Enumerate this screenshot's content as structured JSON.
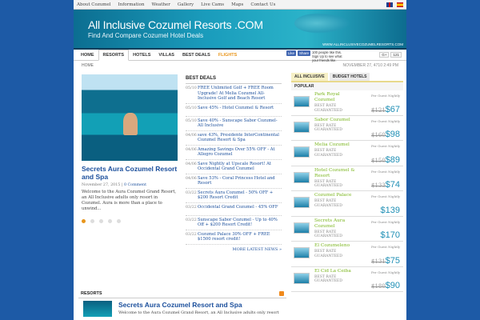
{
  "topnav": [
    "About Cozumel",
    "Information",
    "Weather",
    "Gallery",
    "Live Cams",
    "Maps",
    "Contact Us"
  ],
  "banner": {
    "title": "All Inclusive Cozumel Resorts .COM",
    "subtitle": "Find And Compare Cozumel Hotel Deals",
    "url": "WWW.ALLINCLUSIVECOZUMELRESORTS.COM"
  },
  "mainnav": [
    "HOME",
    "RESORTS",
    "HOTELS",
    "VILLAS",
    "BEST DEALS",
    "FLIGHTS"
  ],
  "facebook": {
    "like": "Like",
    "share": "Share",
    "text": "100 people like this. Sign Up to see what your friends like."
  },
  "gplus": {
    "label": "G+",
    "count": "121"
  },
  "crumbs": {
    "home": "HOME",
    "date": "NOVEMBER 27, 4710 2:49 PM"
  },
  "feature": {
    "title": "Secrets Aura Cozumel Resort and Spa",
    "date": "November 27, 2015",
    "comments": "0 Comment",
    "text": "Welcome to the Aura Cozumel Grand Resort, an All Inclusive adults only resort in Cozumel. Aura is more than a place to unwind..."
  },
  "deals": {
    "heading": "BEST DEALS",
    "items": [
      {
        "date": "05/10",
        "text": "FREE Unlimited Golf + FREE Room Upgrade! At Melia Cozumel All-Inclusive Golf and Beach Resort"
      },
      {
        "date": "05/10",
        "text": "Save 45% - Hotel Cozumel & Resort"
      },
      {
        "date": "05/10",
        "text": "Save 40% - Sunscape Sabor Cozumel-All Inclusive"
      },
      {
        "date": "04/06",
        "text": "save 43%, Presidente InterContinental Cozumel Resort & Spa"
      },
      {
        "date": "04/06",
        "text": "Amazing Savings Over 55% OFF - At Allegro Cozumel"
      },
      {
        "date": "04/06",
        "text": "Save Nightly at Upscale Resort! At Occidental Grand Cozumel"
      },
      {
        "date": "04/06",
        "text": "Save 53% - Coral Princess Hotel and Resort"
      },
      {
        "date": "03/22",
        "text": "Secrets Aura Cozumel - 50% OFF + $200 Resort Credit"
      },
      {
        "date": "03/22",
        "text": "Occidental Grand Cozumel - 45% OFF"
      },
      {
        "date": "03/22",
        "text": "Sunscape Sabor Cozumel - Up to 40% Off + $200 Resort Credit!"
      },
      {
        "date": "03/22",
        "text": "Cozumel Palace 30% OFF + FREE $1500 resort credit!"
      }
    ],
    "more": "MORE LATEST NEWS »"
  },
  "sidebar": {
    "tabs": [
      "ALL INCLUSIVE",
      "BUDGET HOTELS"
    ],
    "popular": "POPULAR",
    "per_guest": "Per Guest Nightly",
    "best_rate": "BEST RATE GUARANTEED",
    "hotels": [
      {
        "name": "Park Royal Cozumel",
        "old": "$121",
        "new": "$67"
      },
      {
        "name": "Sabor Cozumel",
        "old": "$160",
        "new": "$98"
      },
      {
        "name": "Melia Cozumel",
        "old": "$150",
        "new": "$89"
      },
      {
        "name": "Hotel Cozumel & Resort",
        "old": "$133",
        "new": "$74"
      },
      {
        "name": "Cozumel Palace",
        "old": "",
        "new": "$139"
      },
      {
        "name": "Secrets Aura Cozumel",
        "old": "",
        "new": "$170"
      },
      {
        "name": "El Cozumeleno",
        "old": "$131",
        "new": "$75"
      },
      {
        "name": "El Cid La Ceiba",
        "old": "$180",
        "new": "$90"
      }
    ]
  },
  "resorts": {
    "heading": "RESORTS",
    "title": "Secrets Aura Cozumel Resort and Spa",
    "text": "Welcome to the Aura Cozumel Grand Resort, an All Inclusive adults only resort"
  }
}
